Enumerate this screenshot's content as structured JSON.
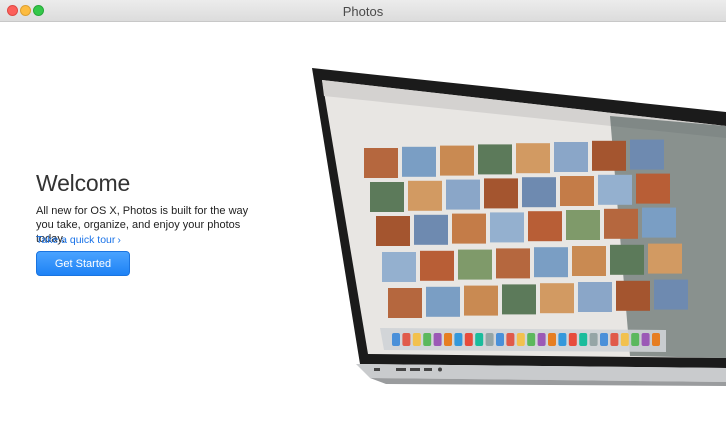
{
  "window": {
    "title": "Photos"
  },
  "welcome": {
    "heading": "Welcome",
    "description": "All new for OS X, Photos is built for the way you take, organize, and enjoy your photos today.",
    "tour_link": "Take a quick tour",
    "tour_chevron": "›",
    "get_started": "Get Started"
  },
  "colors": {
    "accent": "#1a73e8",
    "button": "#1e82f5",
    "close": "#fc605b",
    "minimize": "#fdbc40",
    "maximize": "#34c84a"
  },
  "icons": [
    "close-icon",
    "minimize-icon",
    "maximize-icon",
    "chevron-right-icon",
    "laptop-illustration"
  ]
}
